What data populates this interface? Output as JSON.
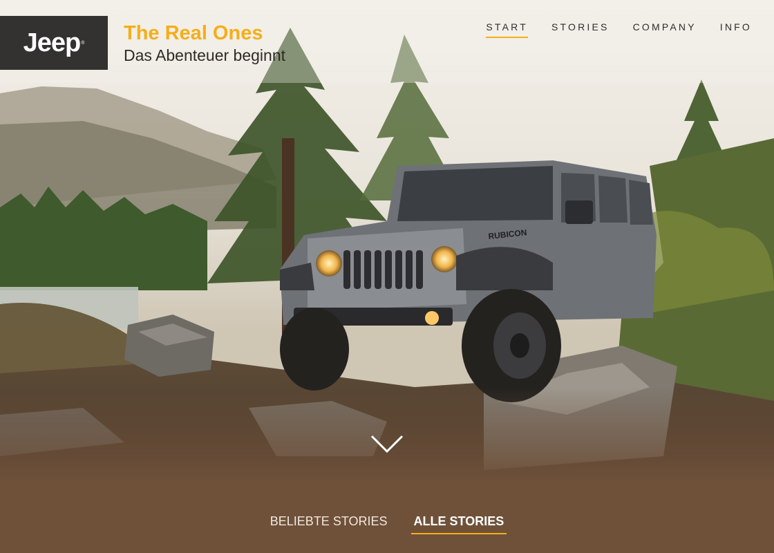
{
  "brand": {
    "logo_text": "Jeep",
    "trademark": "®"
  },
  "header": {
    "title": "The Real Ones",
    "subtitle": "Das Abenteuer beginnt"
  },
  "nav": {
    "items": [
      {
        "label": "START",
        "active": true
      },
      {
        "label": "STORIES",
        "active": false
      },
      {
        "label": "COMPANY",
        "active": false
      },
      {
        "label": "INFO",
        "active": false
      }
    ]
  },
  "hero": {
    "vehicle_badge": "RUBICON",
    "scroll_icon": "chevron-down-icon"
  },
  "tabs": {
    "items": [
      {
        "label": "BELIEBTE STORIES",
        "active": false
      },
      {
        "label": "ALLE STORIES",
        "active": true
      }
    ]
  },
  "colors": {
    "accent": "#f5ae19",
    "logo_bg": "#333231",
    "footer_bg": "#6f513a"
  }
}
